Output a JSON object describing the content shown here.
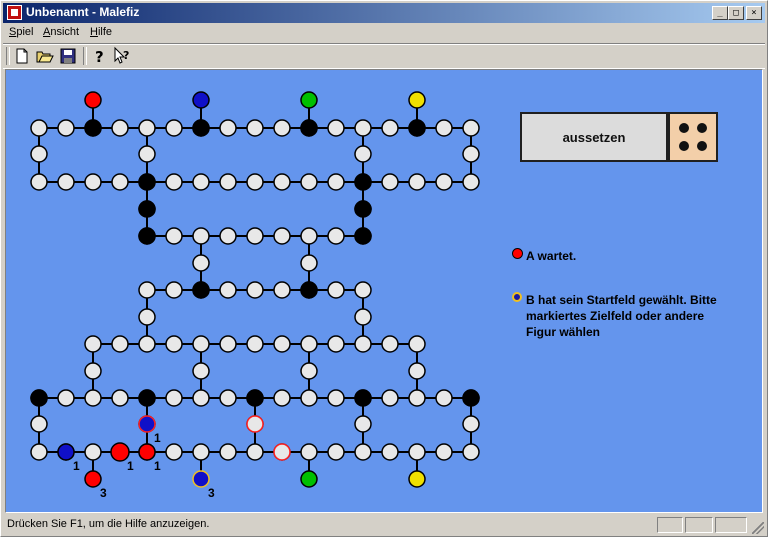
{
  "window": {
    "title": "Unbenannt - Malefiz"
  },
  "caption_buttons": {
    "minimize": "_",
    "maximize": "□",
    "close": "×"
  },
  "menu": [
    "Spiel",
    "Ansicht",
    "Hilfe"
  ],
  "menu_underline": [
    "S",
    "A",
    "H"
  ],
  "toolbar": {
    "items": [
      "new-icon",
      "open-icon",
      "save-icon",
      "help-icon",
      "context-help-icon"
    ]
  },
  "game": {
    "skip_label": "aussetzen",
    "dice_value": 4,
    "messages": [
      {
        "text_lines": [
          "A wartet."
        ],
        "dot_color": "#ff0000"
      },
      {
        "text_lines": [
          "B hat sein Startfeld gewählt. Bitte",
          "markiertes Zielfeld oder andere",
          "Figur wählen"
        ],
        "dot_color": "#1a1aa0"
      }
    ],
    "piece_counts": [
      "1",
      "1",
      "1",
      "1",
      "3",
      "3"
    ]
  },
  "colors": {
    "board_bg": "#6495ed",
    "field": "#e8e8e8",
    "barrier": "#000000",
    "red": "#ff0000",
    "blue": "#1010c8",
    "green": "#00c000",
    "yellow": "#f0e000"
  },
  "status": {
    "text": "Drücken Sie F1, um die Hilfe anzuzeigen."
  }
}
